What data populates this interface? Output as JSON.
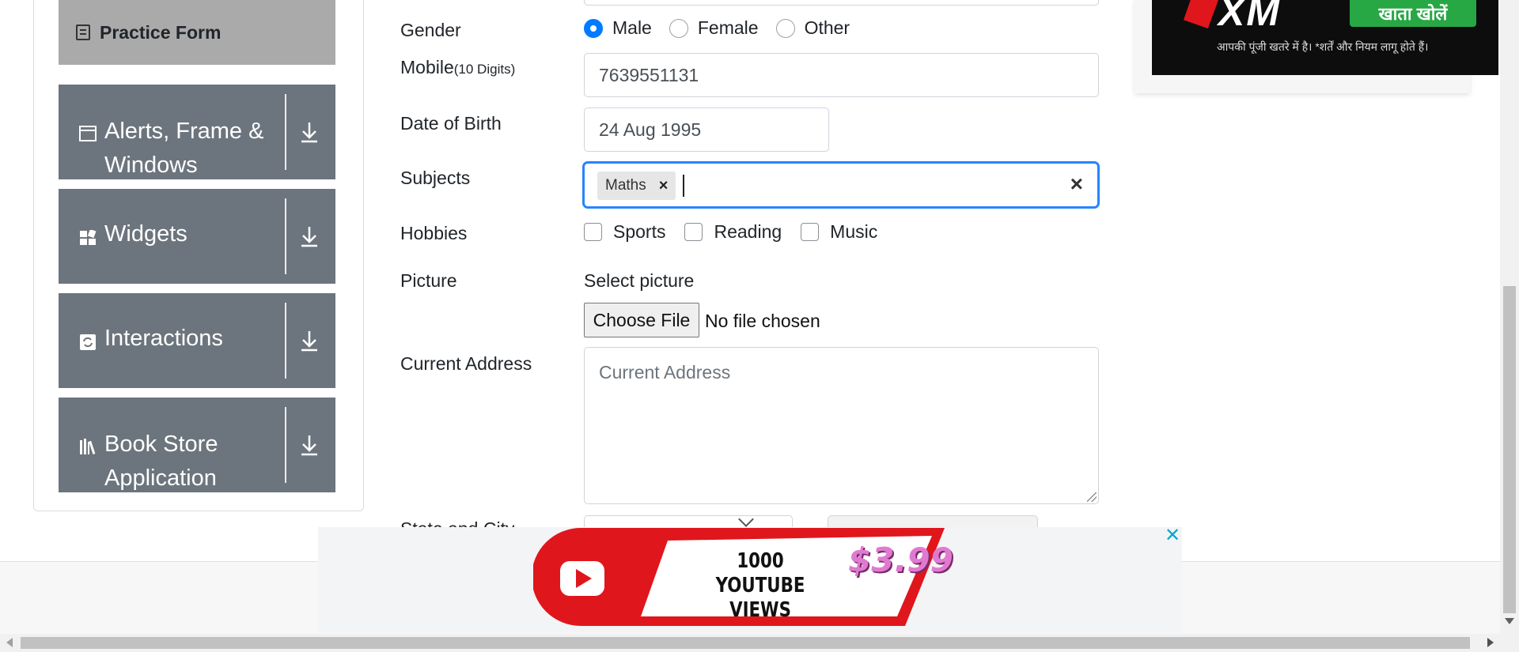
{
  "sidebar": {
    "active_item": "Practice Form",
    "groups": [
      {
        "label": "Alerts, Frame & Windows",
        "icon": "window-icon"
      },
      {
        "label": "Widgets",
        "icon": "widgets-icon"
      },
      {
        "label": "Interactions",
        "icon": "interactions-icon"
      },
      {
        "label": "Book Store Application",
        "icon": "books-icon"
      }
    ]
  },
  "form": {
    "gender": {
      "label": "Gender",
      "options": [
        "Male",
        "Female",
        "Other"
      ],
      "selected": "Male"
    },
    "mobile": {
      "label": "Mobile",
      "hint": "(10 Digits)",
      "value": "7639551131"
    },
    "dob": {
      "label": "Date of Birth",
      "value": "24 Aug 1995"
    },
    "subjects": {
      "label": "Subjects",
      "chips": [
        "Maths"
      ],
      "clear_symbol": "×"
    },
    "hobbies": {
      "label": "Hobbies",
      "options": [
        "Sports",
        "Reading",
        "Music"
      ]
    },
    "picture": {
      "label": "Picture",
      "prompt": "Select picture",
      "button": "Choose File",
      "status": "No file chosen"
    },
    "address": {
      "label": "Current Address",
      "placeholder": "Current Address"
    },
    "state_city": {
      "label": "State and City"
    }
  },
  "ads": {
    "top": {
      "brand": "XM",
      "cta": "खाता खोलें",
      "fine_print": "आपकी पूंजी खतरे में है। *शर्तें और नियम लागू होते हैं।"
    },
    "bottom": {
      "line1": "1000",
      "line2": "YOUTUBE VIEWS",
      "price": "$3.99",
      "close": "✕"
    }
  },
  "colors": {
    "accent": "#007bff",
    "focus": "#2684ff",
    "sidebar": "#6c757d",
    "active": "#aaaaaa",
    "yt_red": "#e0161d"
  }
}
